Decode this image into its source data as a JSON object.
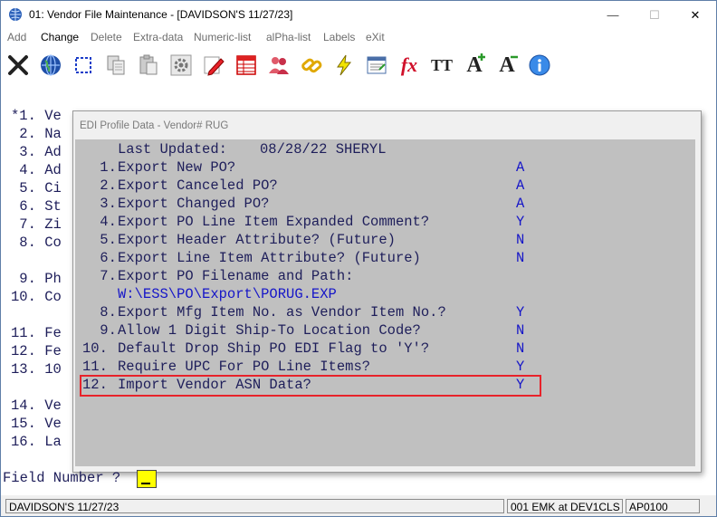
{
  "window": {
    "title": "01: Vendor File Maintenance - [DAVIDSON'S 11/27/23]",
    "controls": {
      "minimize": "—",
      "maximize": "☐",
      "close": "✕"
    }
  },
  "menu": [
    {
      "label": "Add",
      "active": false
    },
    {
      "label": "Change",
      "active": true
    },
    {
      "label": "Delete",
      "active": false
    },
    {
      "label": "Extra-data",
      "active": false
    },
    {
      "label": "Numeric-list",
      "active": false
    },
    {
      "label": "alPha-list",
      "active": false
    },
    {
      "label": "Labels",
      "active": false
    },
    {
      "label": "eXit",
      "active": false
    }
  ],
  "toolbar_icons": [
    "close-x-icon",
    "globe-icon",
    "select-icon",
    "copy-icon",
    "paste-icon",
    "settings-gear-icon",
    "edit-pencil-icon",
    "table-icon",
    "users-icon",
    "link-icon",
    "lightning-icon",
    "spreadsheet-icon",
    "function-icon",
    "text-size-icon",
    "font-increase-icon",
    "font-decrease-icon",
    "help-icon"
  ],
  "toolbar_text": {
    "fx": "fx",
    "tt": "TT",
    "a_plus": "A",
    "a_minus": "A"
  },
  "background_fields": [
    "*1. Ve",
    " 2. Na",
    " 3. Ad",
    " 4. Ad",
    " 5. Ci",
    " 6. St",
    " 7. Zi",
    " 8. Co",
    "",
    " 9. Ph",
    "10. Co",
    "",
    "11. Fe",
    "12. Fe",
    "13. 10",
    "",
    "14. Ve",
    "15. Ve",
    "16. La"
  ],
  "dialog": {
    "title": "EDI Profile Data - Vendor#  RUG",
    "last_updated_label": "Last Updated:",
    "last_updated_value": "08/28/22 SHERYL",
    "items": [
      {
        "num": " 1.",
        "label": "Export New PO?",
        "value": "A"
      },
      {
        "num": " 2.",
        "label": "Export Canceled PO?",
        "value": "A"
      },
      {
        "num": " 3.",
        "label": "Export Changed PO?",
        "value": "A"
      },
      {
        "num": " 4.",
        "label": "Export PO Line Item Expanded Comment?",
        "value": "Y"
      },
      {
        "num": " 5.",
        "label": "Export Header Attribute? (Future)",
        "value": "N"
      },
      {
        "num": " 6.",
        "label": "Export Line Item Attribute? (Future)",
        "value": "N"
      },
      {
        "num": " 7.",
        "label": "Export PO Filename and Path:",
        "value": ""
      },
      {
        "num": "",
        "label": "",
        "value": "",
        "path": "W:\\ESS\\PO\\Export\\PORUG.EXP"
      },
      {
        "num": " 8.",
        "label": "Export Mfg Item No. as Vendor Item No.?",
        "value": "Y"
      },
      {
        "num": " 9.",
        "label": "Allow 1 Digit Ship-To Location Code?",
        "value": "N"
      },
      {
        "num": "10.",
        "label": "Default Drop Ship PO EDI Flag to 'Y'?",
        "value": "N"
      },
      {
        "num": "11.",
        "label": "Require UPC For PO Line Items?",
        "value": "Y"
      },
      {
        "num": "12.",
        "label": "Import Vendor ASN Data?",
        "value": "Y"
      }
    ]
  },
  "prompt": {
    "label": "Field Number ?",
    "input_value": ""
  },
  "status": {
    "company": "DAVIDSON'S 11/27/23",
    "empty_pane": "",
    "user": "001 EMK at DEV1CLS",
    "program": "AP0100"
  },
  "colors": {
    "highlight_border": "#e8222a",
    "input_bg": "#ffff00",
    "dialog_bg": "#c0c0c0",
    "value_blue": "#1515c8"
  }
}
